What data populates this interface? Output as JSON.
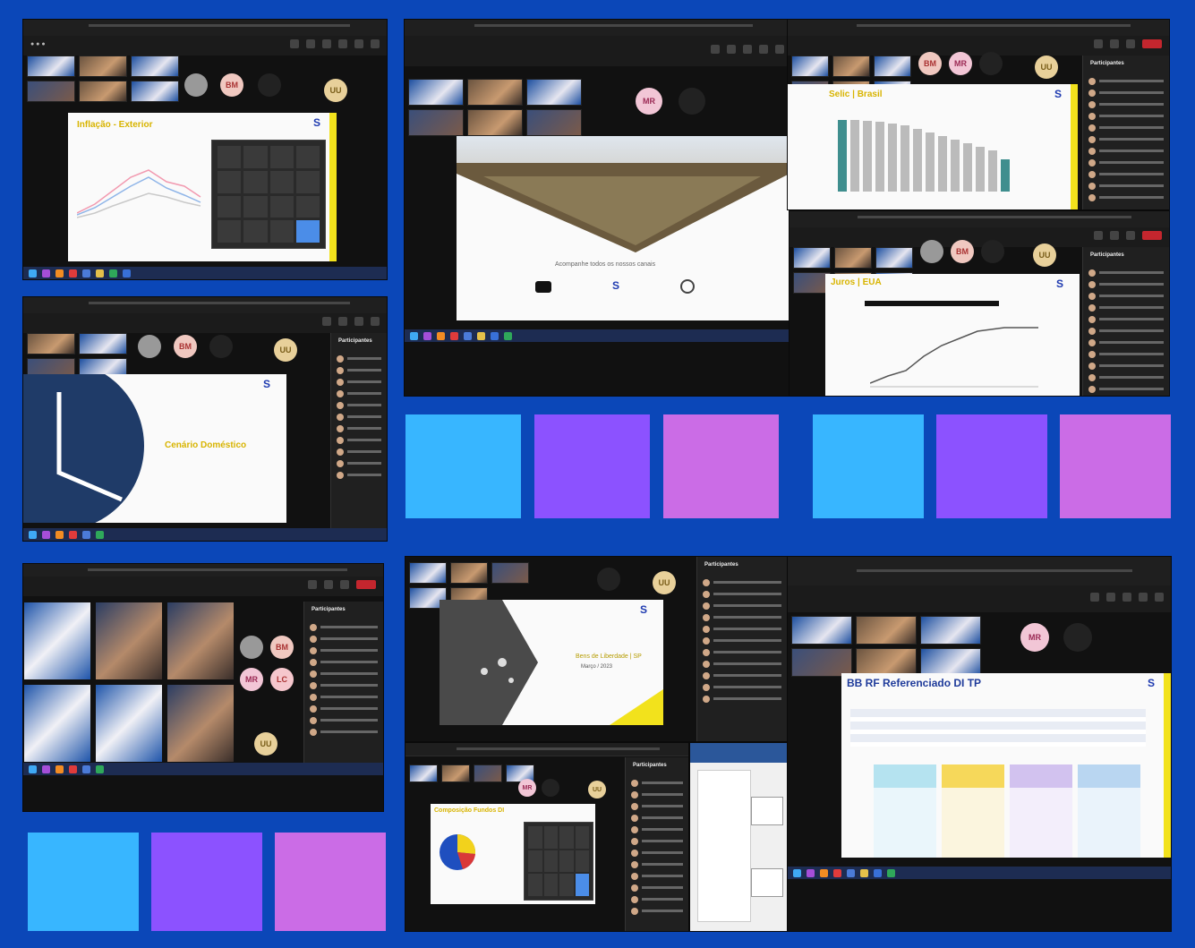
{
  "screens": {
    "inflacao": {
      "title": "Inflação - Exterior"
    },
    "cenario": {
      "title": "Cenário Doméstico"
    },
    "selic": {
      "title": "Selic | Brasil"
    },
    "juros": {
      "title": "Juros | EUA"
    },
    "fundo": {
      "title": "BB RF Referenciado DI TP"
    },
    "abertura": {
      "title": "Acompanhe todos os nossos canais"
    },
    "abertura2": {
      "title": "Bens de Liberdade | SP",
      "subtitle": "Março / 2023"
    },
    "composicao": {
      "title": "Composição Fundos DI"
    }
  },
  "avatars": {
    "bm": "BM",
    "mr": "MR",
    "uu": "UU",
    "lc": "LC"
  },
  "participants_label": "Participantes",
  "colors": {
    "background": "#0b47b8",
    "sq_cyan": "#38b6ff",
    "sq_violet": "#8c52ff",
    "sq_magenta": "#cb6ce6",
    "slide_yellow": "#f2e21c"
  }
}
